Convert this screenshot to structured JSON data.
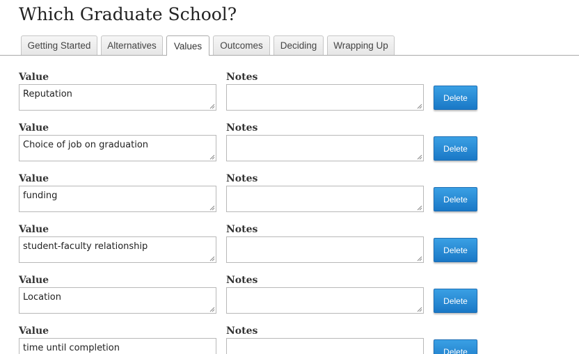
{
  "page": {
    "title": "Which Graduate School?"
  },
  "tabs": [
    {
      "label": "Getting Started",
      "active": false
    },
    {
      "label": "Alternatives",
      "active": false
    },
    {
      "label": "Values",
      "active": true
    },
    {
      "label": "Outcomes",
      "active": false
    },
    {
      "label": "Deciding",
      "active": false
    },
    {
      "label": "Wrapping Up",
      "active": false
    }
  ],
  "value_rows": [
    {
      "value_label": "Value",
      "notes_label": "Notes",
      "value": "Reputation",
      "notes": "",
      "delete_label": "Delete"
    },
    {
      "value_label": "Value",
      "notes_label": "Notes",
      "value": "Choice of job on graduation",
      "notes": "",
      "delete_label": "Delete"
    },
    {
      "value_label": "Value",
      "notes_label": "Notes",
      "value": "funding",
      "notes": "",
      "delete_label": "Delete"
    },
    {
      "value_label": "Value",
      "notes_label": "Notes",
      "value": "student-faculty relationship",
      "notes": "",
      "delete_label": "Delete"
    },
    {
      "value_label": "Value",
      "notes_label": "Notes",
      "value": "Location",
      "notes": "",
      "delete_label": "Delete"
    },
    {
      "value_label": "Value",
      "notes_label": "Notes",
      "value": "time until completion",
      "notes": "",
      "delete_label": "Delete"
    }
  ],
  "colors": {
    "button_blue": "#1a78c6",
    "text": "#222222",
    "border": "#b8b8b8"
  }
}
